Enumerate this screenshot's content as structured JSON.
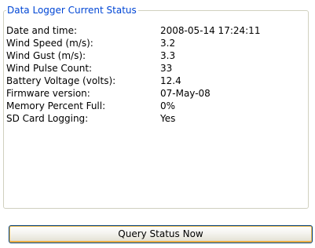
{
  "status_group": {
    "title": "Data Logger Current Status"
  },
  "rows": [
    {
      "label": "Date and time:",
      "value": "2008-05-14 17:24:11"
    },
    {
      "label": "Wind Speed (m/s):",
      "value": "3.2"
    },
    {
      "label": "Wind Gust (m/s):",
      "value": "3.3"
    },
    {
      "label": "Wind Pulse Count:",
      "value": "33"
    },
    {
      "label": "Battery Voltage (volts):",
      "value": "12.4"
    },
    {
      "label": "Firmware version:",
      "value": "07-May-08"
    },
    {
      "label": "Memory Percent Full:",
      "value": "0%"
    },
    {
      "label": "SD Card Logging:",
      "value": "Yes"
    }
  ],
  "query_button": {
    "label": "Query Status Now"
  },
  "colors": {
    "group_title": "#0046d5",
    "group_border": "#d0d0bf",
    "button_border": "#003c74",
    "button_focus": "#f7c45b"
  }
}
